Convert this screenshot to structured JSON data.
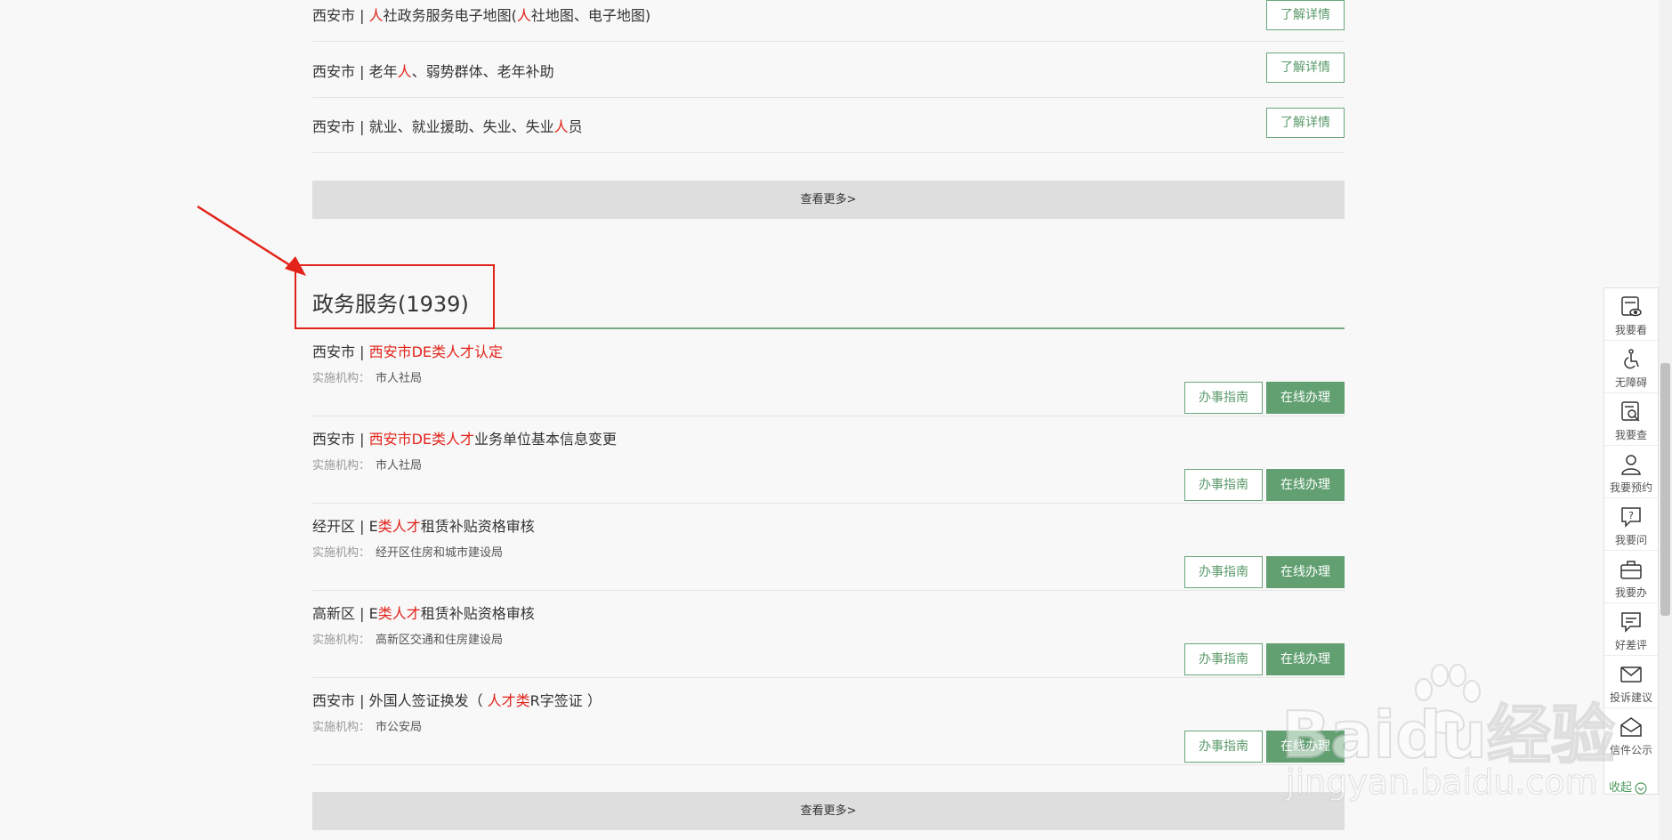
{
  "top_list": {
    "items": [
      {
        "pre": "西安市 | ",
        "hl1": "人",
        "mid": "社政务服务电子地图(",
        "hl2": "人",
        "post": "社地图、电子地图)"
      },
      {
        "pre": "西安市 | 老年",
        "hl1": "人",
        "mid": "、弱势群体、老年补助",
        "hl2": "",
        "post": ""
      },
      {
        "pre": "西安市 | 就业、就业援助、失业、失业",
        "hl1": "人",
        "mid": "员",
        "hl2": "",
        "post": ""
      }
    ],
    "detail_label": "了解详情",
    "more_label": "查看更多>"
  },
  "gov_services": {
    "title": "政务服务(1939)",
    "org_key": "实施机构：",
    "guide_label": "办事指南",
    "online_label": "在线办理",
    "more_label": "查看更多>",
    "items": [
      {
        "pre": "西安市 | ",
        "hl": "西安市DE类人才认定",
        "post": "",
        "tail": "",
        "org": "市人社局"
      },
      {
        "pre": "西安市 | ",
        "hl": "西安市DE类人才",
        "post": "业务单位基本信息变更",
        "tail": "",
        "org": "市人社局"
      },
      {
        "pre": "经开区 | E",
        "hl": "类人才",
        "post": "租赁补贴资格审核",
        "tail": "",
        "org": "经开区住房和城市建设局"
      },
      {
        "pre": "高新区 | E",
        "hl": "类人才",
        "post": "租赁补贴资格审核",
        "tail": "",
        "org": "高新区交通和住房建设局"
      },
      {
        "pre": "西安市 | 外国人签证换发（ ",
        "hl": "人才类",
        "post": "R字签证 ）",
        "tail": "",
        "org": "市公安局"
      }
    ]
  },
  "sidebar": {
    "items": [
      {
        "label": "我要看",
        "icon": "eye-doc-icon"
      },
      {
        "label": "无障碍",
        "icon": "wheelchair-icon"
      },
      {
        "label": "我要查",
        "icon": "search-doc-icon"
      },
      {
        "label": "我要预约",
        "icon": "user-icon"
      },
      {
        "label": "我要问",
        "icon": "question-icon"
      },
      {
        "label": "我要办",
        "icon": "briefcase-icon"
      },
      {
        "label": "好差评",
        "icon": "comment-icon"
      },
      {
        "label": "投诉建议",
        "icon": "mail-icon"
      },
      {
        "label": "信件公示",
        "icon": "open-mail-icon"
      }
    ],
    "collapse_label": "收起"
  },
  "watermark": {
    "line1": "Baidu经验",
    "line2": "jingyan.baidu.com"
  },
  "colors": {
    "accent_green": "#62a072",
    "highlight_red": "#e2231a",
    "annotation_red": "#e2231a"
  }
}
